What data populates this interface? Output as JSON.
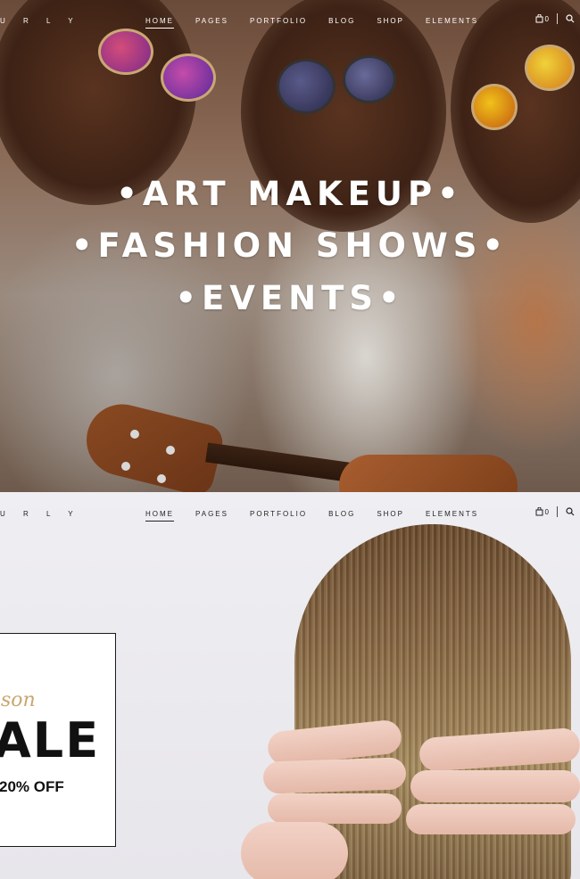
{
  "nav_top": {
    "logo": "U R L Y",
    "menu": [
      "HOME",
      "PAGES",
      "PORTFOLIO",
      "BLOG",
      "SHOP",
      "ELEMENTS"
    ],
    "active_index": 0,
    "cart_count": "0"
  },
  "hero": {
    "line1": "•ART MAKEUP•",
    "line2": "•FASHION SHOWS•",
    "line3": "•EVENTS•"
  },
  "nav_bottom": {
    "logo": "U R L Y",
    "menu": [
      "HOME",
      "PAGES",
      "PORTFOLIO",
      "BLOG",
      "SHOP",
      "ELEMENTS"
    ],
    "active_index": 0,
    "cart_count": "0"
  },
  "promo": {
    "script": "son",
    "big": "ALE",
    "off": "20% OFF"
  },
  "colors": {
    "accent_gold": "#c8a66e",
    "text_dark": "#111111"
  },
  "icons": {
    "cart": "cart-icon",
    "search": "search-icon"
  }
}
